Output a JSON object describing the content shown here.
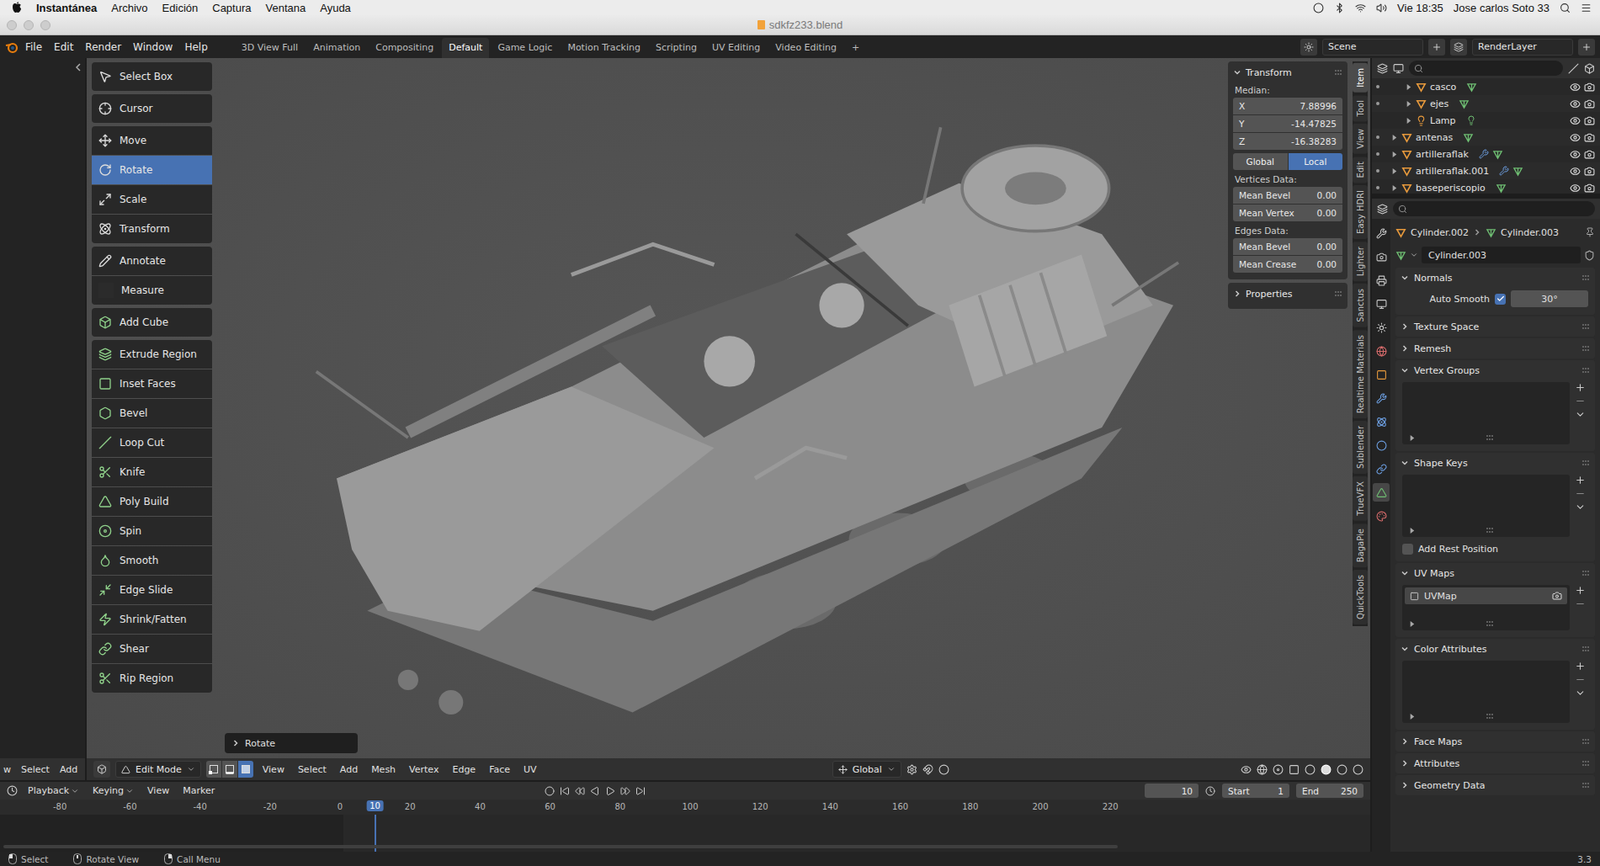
{
  "menubar": {
    "app": "Instantánea",
    "items": [
      "Archivo",
      "Edición",
      "Captura",
      "Ventana",
      "Ayuda"
    ],
    "clock": "Vie 18:35",
    "user": "Jose carlos Soto 33"
  },
  "window": {
    "title": "sdkfz233.blend"
  },
  "topbar": {
    "menus": [
      "File",
      "Edit",
      "Render",
      "Window",
      "Help"
    ],
    "workspaces": [
      {
        "label": "3D View Full",
        "selected": false
      },
      {
        "label": "Animation",
        "selected": false
      },
      {
        "label": "Compositing",
        "selected": false
      },
      {
        "label": "Default",
        "selected": true
      },
      {
        "label": "Game Logic",
        "selected": false
      },
      {
        "label": "Motion Tracking",
        "selected": false
      },
      {
        "label": "Scripting",
        "selected": false
      },
      {
        "label": "UV Editing",
        "selected": false
      },
      {
        "label": "Video Editing",
        "selected": false
      }
    ],
    "add_workspace": "+",
    "scene": "Scene",
    "view_layer": "RenderLayer"
  },
  "left_editor": {
    "header_menus": [
      "w",
      "Select",
      "Add"
    ]
  },
  "toolbar": {
    "groups": [
      [
        {
          "label": "Select Box",
          "selected": false
        }
      ],
      [
        {
          "label": "Cursor",
          "selected": false
        }
      ],
      [
        {
          "label": "Move",
          "selected": false
        },
        {
          "label": "Rotate",
          "selected": true
        },
        {
          "label": "Scale",
          "selected": false
        },
        {
          "label": "Transform",
          "selected": false
        }
      ],
      [
        {
          "label": "Annotate",
          "selected": false
        },
        {
          "label": "Measure",
          "selected": false
        }
      ],
      [
        {
          "label": "Add Cube",
          "selected": false
        }
      ],
      [
        {
          "label": "Extrude Region",
          "selected": false
        },
        {
          "label": "Inset Faces",
          "selected": false
        },
        {
          "label": "Bevel",
          "selected": false
        },
        {
          "label": "Loop Cut",
          "selected": false
        },
        {
          "label": "Knife",
          "selected": false
        },
        {
          "label": "Poly Build",
          "selected": false
        },
        {
          "label": "Spin",
          "selected": false
        },
        {
          "label": "Smooth",
          "selected": false
        },
        {
          "label": "Edge Slide",
          "selected": false
        },
        {
          "label": "Shrink/Fatten",
          "selected": false
        },
        {
          "label": "Shear",
          "selected": false
        },
        {
          "label": "Rip Region",
          "selected": false
        }
      ]
    ]
  },
  "redo_panel": {
    "label": "Rotate",
    "expanded": false
  },
  "transform_panel": {
    "title": "Transform",
    "expanded": true,
    "median_label": "Median:",
    "fields": [
      {
        "axis": "X",
        "value": "7.88996"
      },
      {
        "axis": "Y",
        "value": "-14.47825"
      },
      {
        "axis": "Z",
        "value": "-16.38283"
      }
    ],
    "space": [
      {
        "label": "Global",
        "selected": false
      },
      {
        "label": "Local",
        "selected": true
      }
    ],
    "sections": [
      {
        "title": "Vertices Data:",
        "fields": [
          {
            "label": "Mean Bevel",
            "value": "0.00"
          },
          {
            "label": "Mean Vertex",
            "value": "0.00"
          }
        ]
      },
      {
        "title": "Edges Data:",
        "fields": [
          {
            "label": "Mean Bevel",
            "value": "0.00"
          },
          {
            "label": "Mean Crease",
            "value": "0.00"
          }
        ]
      }
    ],
    "properties": {
      "title": "Properties",
      "expanded": false
    }
  },
  "sidebar_tabs": [
    {
      "label": "Item",
      "selected": true
    },
    {
      "label": "Tool",
      "selected": false
    },
    {
      "label": "View",
      "selected": false
    },
    {
      "label": "Edit",
      "selected": false
    },
    {
      "label": "Easy HDRI",
      "selected": false
    },
    {
      "label": "Lighter",
      "selected": false
    },
    {
      "label": "Sanctus",
      "selected": false
    },
    {
      "label": "Realtime Materials",
      "selected": false
    },
    {
      "label": "Sublender",
      "selected": false
    },
    {
      "label": "TrueVFX",
      "selected": false
    },
    {
      "label": "BagaPie",
      "selected": false
    },
    {
      "label": "QuickTools",
      "selected": false
    }
  ],
  "viewport_header": {
    "mode": "Edit Mode",
    "select_modes": [
      {
        "kind": "vertex",
        "selected": false
      },
      {
        "kind": "edge",
        "selected": false
      },
      {
        "kind": "face",
        "selected": true
      }
    ],
    "menus": [
      "View",
      "Select",
      "Add",
      "Mesh",
      "Vertex",
      "Edge",
      "Face",
      "UV"
    ],
    "orientation": "Global"
  },
  "timeline": {
    "menus": [
      {
        "label": "Playback",
        "dropdown": true
      },
      {
        "label": "Keying",
        "dropdown": true
      },
      {
        "label": "View",
        "dropdown": false
      },
      {
        "label": "Marker",
        "dropdown": false
      }
    ],
    "current_frame": "10",
    "start": {
      "label": "Start",
      "value": "1"
    },
    "end": {
      "label": "End",
      "value": "250"
    },
    "ticks": [
      "-80",
      "-60",
      "-40",
      "-20",
      "0",
      "20",
      "40",
      "60",
      "80",
      "100",
      "120",
      "140",
      "160",
      "180",
      "200",
      "220"
    ],
    "playhead": "10"
  },
  "outliner": {
    "rows": [
      {
        "name": "casco",
        "depth": 1,
        "kind": "mesh",
        "mode_dot": true,
        "modifiers": false,
        "visible": true,
        "renderable": true
      },
      {
        "name": "ejes",
        "depth": 1,
        "kind": "mesh",
        "mode_dot": true,
        "modifiers": false,
        "visible": true,
        "renderable": true
      },
      {
        "name": "Lamp",
        "depth": 1,
        "kind": "light",
        "mode_dot": false,
        "modifiers": false,
        "visible": true,
        "renderable": true
      },
      {
        "name": "antenas",
        "depth": 0,
        "kind": "mesh",
        "mode_dot": true,
        "modifiers": false,
        "visible": true,
        "renderable": true
      },
      {
        "name": "artilleraflak",
        "depth": 0,
        "kind": "mesh",
        "mode_dot": true,
        "modifiers": true,
        "visible": true,
        "renderable": true
      },
      {
        "name": "artilleraflak.001",
        "depth": 0,
        "kind": "mesh",
        "mode_dot": true,
        "modifiers": true,
        "visible": true,
        "renderable": true
      },
      {
        "name": "baseperiscopio",
        "depth": 0,
        "kind": "mesh",
        "mode_dot": true,
        "modifiers": false,
        "visible": true,
        "renderable": true
      }
    ]
  },
  "properties": {
    "tabs": [
      {
        "kind": "tool",
        "selected": false
      },
      {
        "kind": "render",
        "selected": false
      },
      {
        "kind": "output",
        "selected": false
      },
      {
        "kind": "view_layer",
        "selected": false
      },
      {
        "kind": "scene",
        "selected": false
      },
      {
        "kind": "world",
        "selected": false
      },
      {
        "kind": "object",
        "selected": false
      },
      {
        "kind": "modifiers",
        "selected": false
      },
      {
        "kind": "particles",
        "selected": false
      },
      {
        "kind": "physics",
        "selected": false
      },
      {
        "kind": "constraints",
        "selected": false
      },
      {
        "kind": "data",
        "selected": true
      },
      {
        "kind": "material",
        "selected": false
      }
    ],
    "breadcrumb": [
      "Cylinder.002",
      "Cylinder.003"
    ],
    "name": "Cylinder.003",
    "sections": [
      {
        "title": "Normals",
        "expanded": true,
        "kind": "normals",
        "toggle": {
          "label": "Auto Smooth",
          "checked": true,
          "value": "30°"
        }
      },
      {
        "title": "Texture Space",
        "expanded": false,
        "kind": "plain"
      },
      {
        "title": "Remesh",
        "expanded": false,
        "kind": "plain"
      },
      {
        "title": "Vertex Groups",
        "expanded": true,
        "kind": "list",
        "items": [],
        "buttons": [
          "add",
          "remove",
          "menu"
        ]
      },
      {
        "title": "Shape Keys",
        "expanded": true,
        "kind": "list",
        "items": [],
        "buttons": [
          "add",
          "remove",
          "menu"
        ],
        "option": {
          "label": "Add Rest Position",
          "checked": false
        }
      },
      {
        "title": "UV Maps",
        "expanded": true,
        "kind": "list",
        "items": [
          {
            "name": "UVMap",
            "selected": true,
            "active_render": true
          }
        ],
        "buttons": [
          "add",
          "remove"
        ]
      },
      {
        "title": "Color Attributes",
        "expanded": true,
        "kind": "list",
        "items": [],
        "buttons": [
          "add",
          "remove",
          "menu"
        ]
      },
      {
        "title": "Face Maps",
        "expanded": false,
        "kind": "plain"
      },
      {
        "title": "Attributes",
        "expanded": false,
        "kind": "plain"
      },
      {
        "title": "Geometry Data",
        "expanded": false,
        "kind": "plain"
      }
    ]
  },
  "status_bar": {
    "items": [
      {
        "label": "Select",
        "button": "left"
      },
      {
        "label": "Rotate View",
        "button": "middle"
      },
      {
        "label": "Call Menu",
        "button": "right"
      }
    ],
    "version": "3.3"
  }
}
